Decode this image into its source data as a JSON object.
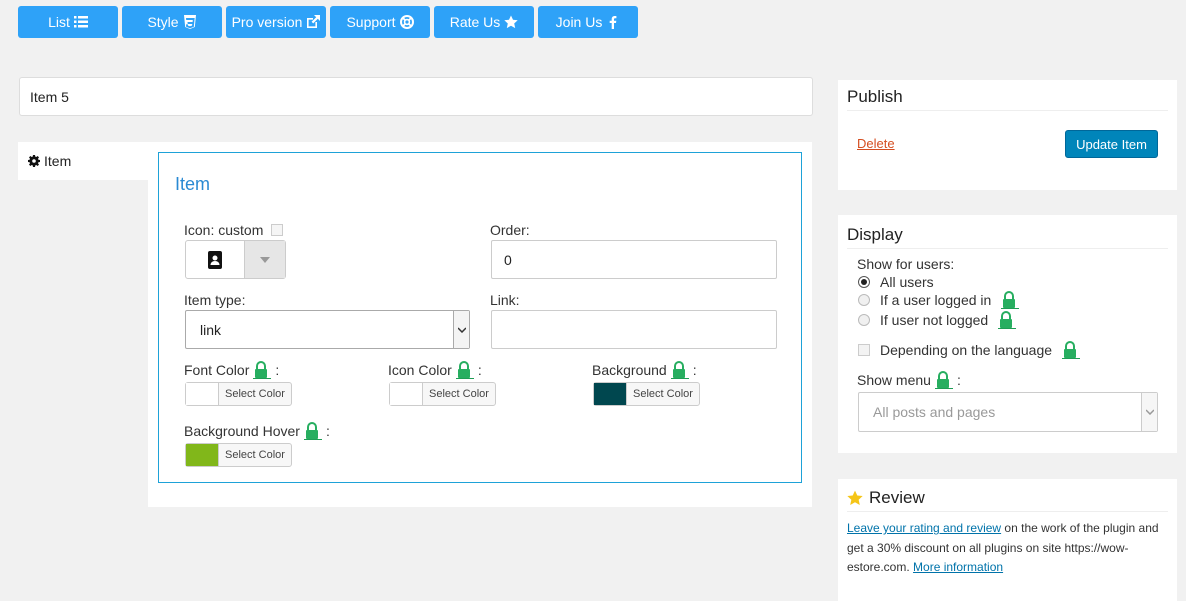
{
  "topnav": [
    {
      "label": "List",
      "icon": "list-icon"
    },
    {
      "label": "Style",
      "icon": "css3-icon"
    },
    {
      "label": "Pro version",
      "icon": "external-link-icon"
    },
    {
      "label": "Support",
      "icon": "lifebuoy-icon"
    },
    {
      "label": "Rate Us",
      "icon": "star-icon"
    },
    {
      "label": "Join Us",
      "icon": "facebook-icon"
    }
  ],
  "title_input": {
    "value": "Item 5"
  },
  "tab": {
    "label": "Item"
  },
  "item_section": {
    "title": "Item",
    "icon_label": "Icon: custom",
    "order_label": "Order:",
    "order_value": "0",
    "item_type_label": "Item type:",
    "item_type_value": "link",
    "link_label": "Link:",
    "link_value": "",
    "font_color_label": "Font Color",
    "icon_color_label": "Icon Color",
    "background_label": "Background",
    "background_hover_label": "Background Hover",
    "colon": ":",
    "select_color": "Select Color",
    "colors": {
      "font": "#ffffff",
      "icon": "#ffffff",
      "background": "#00474f",
      "background_hover": "#81b71a"
    }
  },
  "publish": {
    "title": "Publish",
    "delete": "Delete",
    "update": "Update Item"
  },
  "display": {
    "title": "Display",
    "show_for_users": "Show for users:",
    "options": [
      "All users",
      "If a user logged in",
      "If user not logged"
    ],
    "language": "Depending on the language",
    "show_menu": "Show menu",
    "colon": ":",
    "show_menu_value": "All posts and pages"
  },
  "review": {
    "title": "Review",
    "link1": "Leave your rating and review",
    "text1": " on the work of the plugin and get a 30% discount on all plugins on site https://wow-estore.com. ",
    "link2": "More information"
  },
  "accent": "#2ea2f8",
  "lock_color": "#27ae60"
}
